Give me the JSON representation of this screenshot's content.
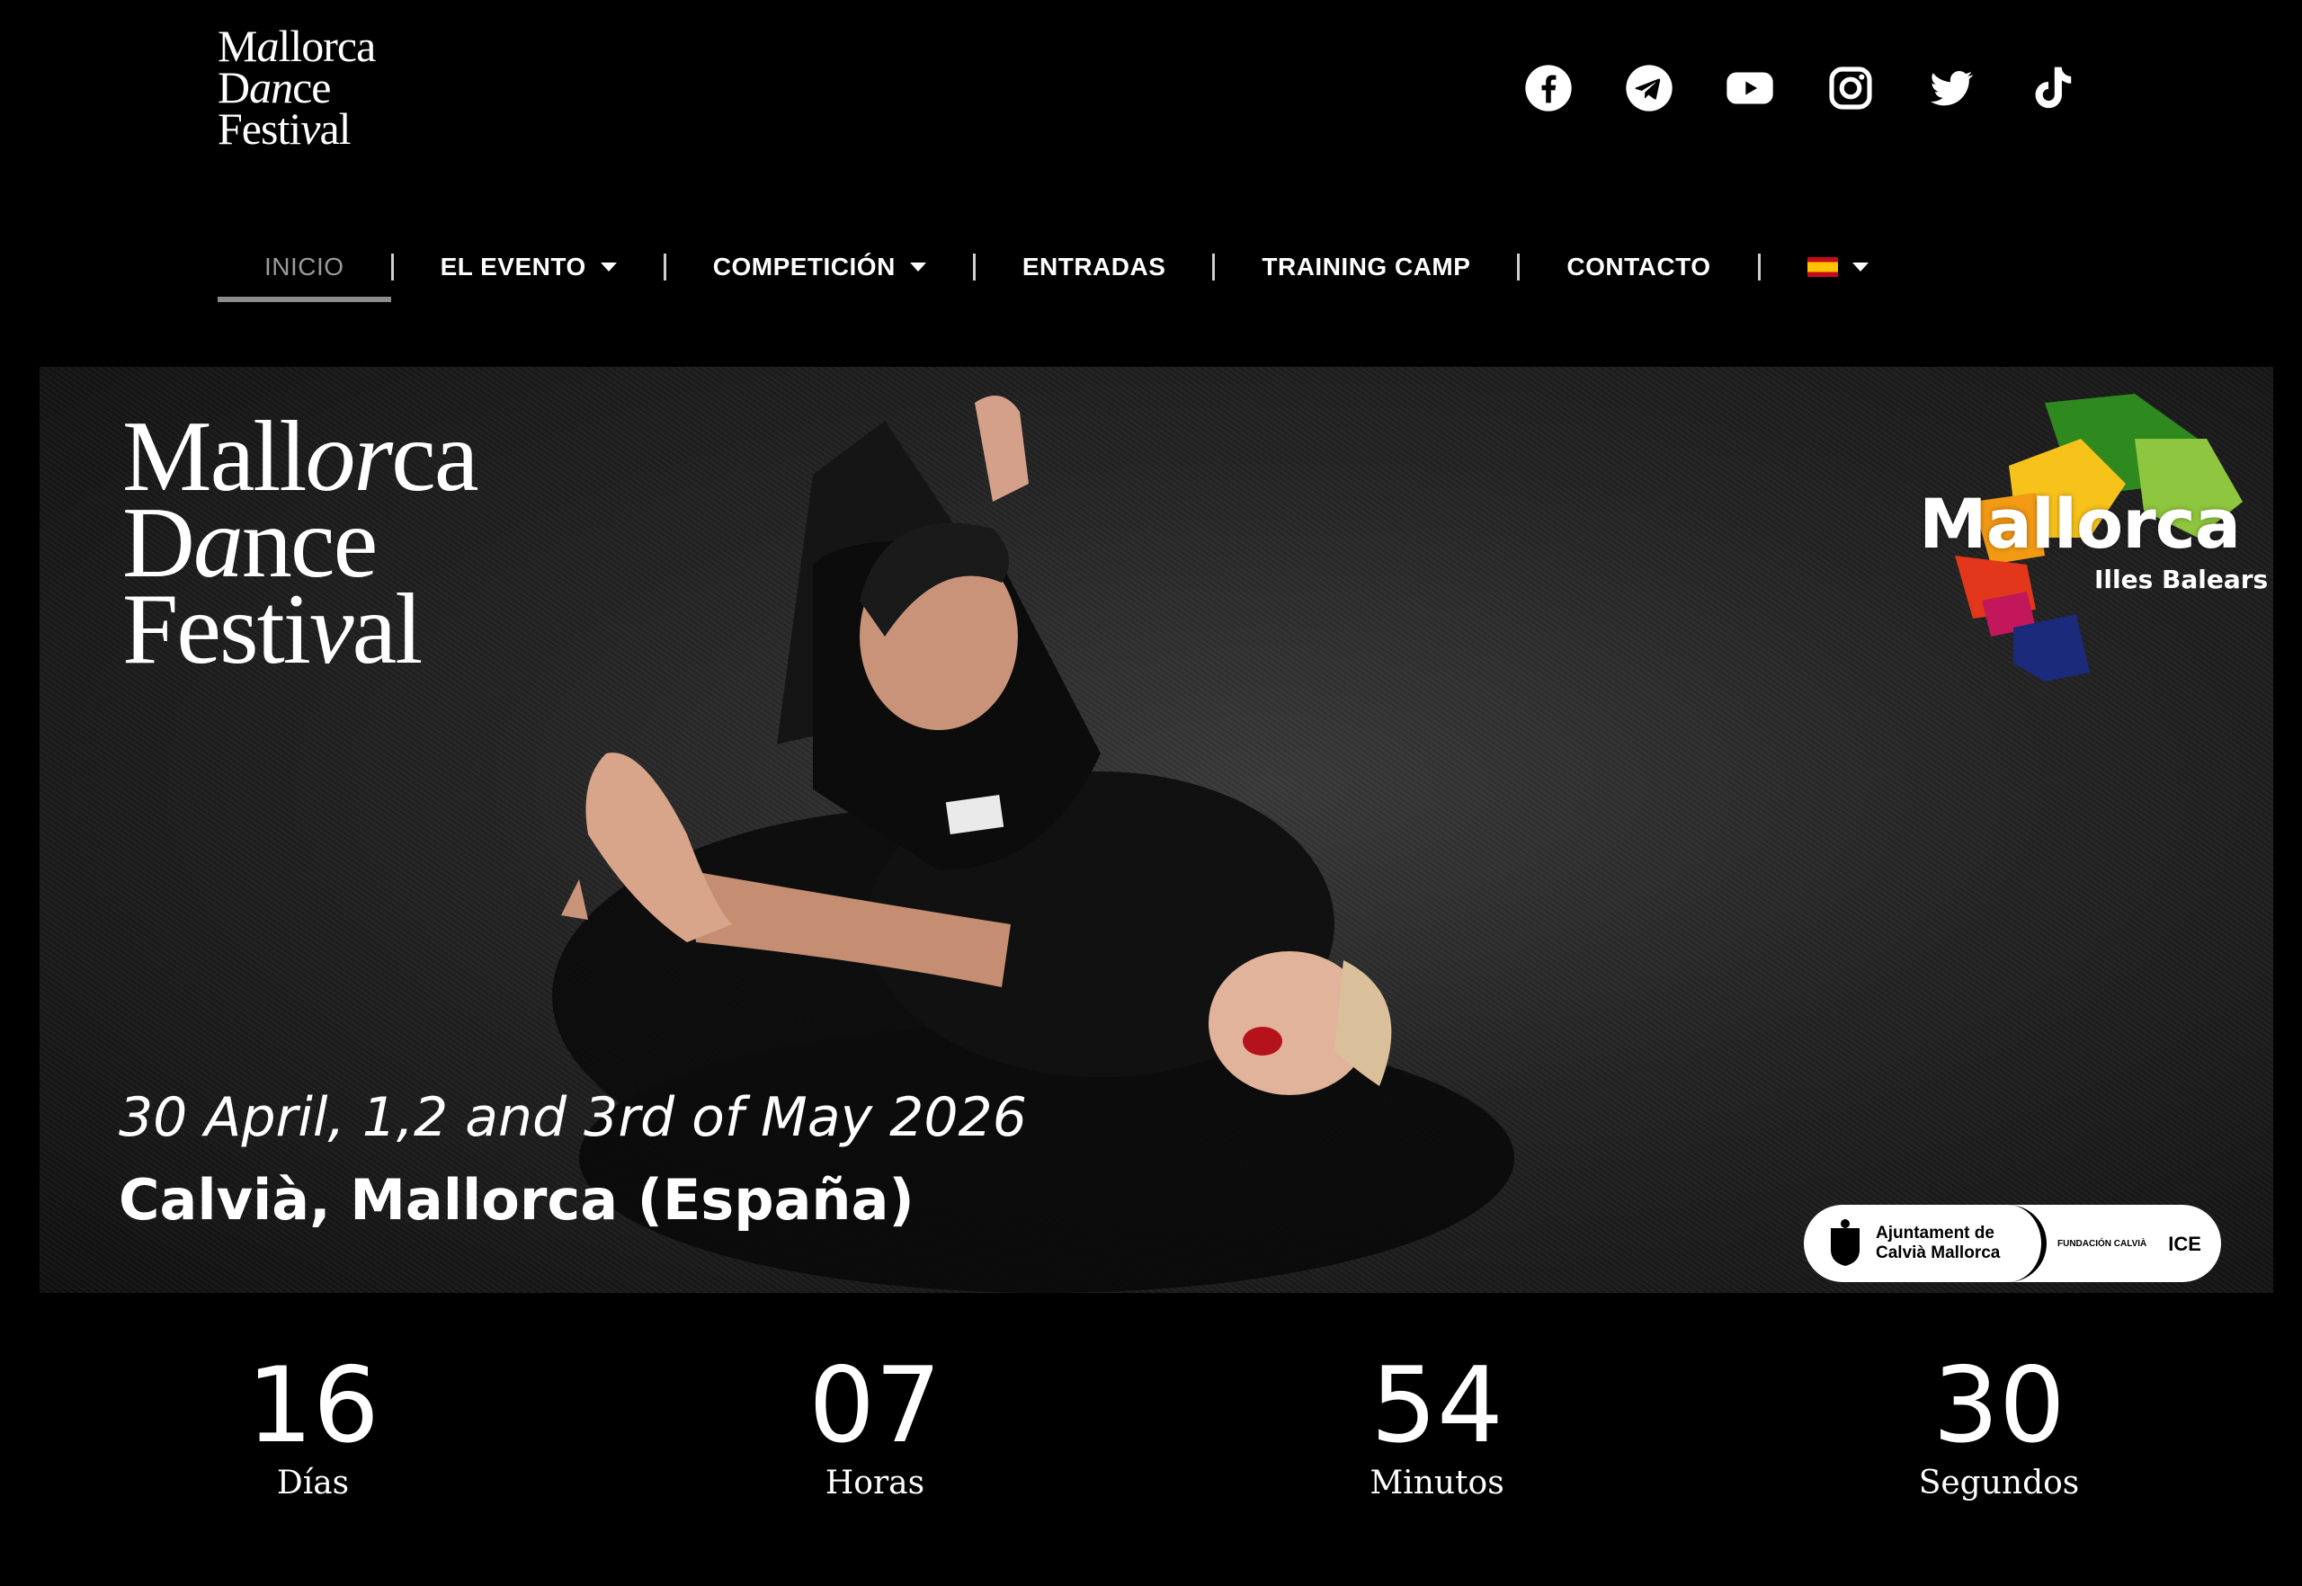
{
  "header": {
    "logo_lines": [
      "Mallorca",
      "Dance",
      "Festival"
    ]
  },
  "social": [
    {
      "name": "facebook-icon"
    },
    {
      "name": "telegram-icon"
    },
    {
      "name": "youtube-icon"
    },
    {
      "name": "instagram-icon"
    },
    {
      "name": "twitter-icon"
    },
    {
      "name": "tiktok-icon"
    }
  ],
  "nav": {
    "items": [
      {
        "label": "INICIO",
        "active": true
      },
      {
        "label": "EL EVENTO",
        "dropdown": true
      },
      {
        "label": "COMPETICIÓN",
        "dropdown": true
      },
      {
        "label": "ENTRADAS"
      },
      {
        "label": "TRAINING CAMP"
      },
      {
        "label": "CONTACTO"
      }
    ],
    "language": "es"
  },
  "banner": {
    "logo_lines": [
      "Mallorca",
      "Dance",
      "Festival"
    ],
    "date": "30 April, 1,2 and 3rd of May 2026",
    "place": "Calvià, Mallorca (España)",
    "brand": "Mallorca",
    "brand_sub": "Illes Balears",
    "sponsor": {
      "line1": "Ajuntament de",
      "line2": "Calvià Mallorca",
      "fundacion": "FUNDACIÓN CALVIÀ",
      "ice": "ICE"
    }
  },
  "countdown": [
    {
      "value": "16",
      "label": "Días"
    },
    {
      "value": "07",
      "label": "Horas"
    },
    {
      "value": "54",
      "label": "Minutos"
    },
    {
      "value": "30",
      "label": "Segundos"
    }
  ],
  "colors": {
    "background": "#000000",
    "active_nav": "#9a9a9a",
    "text": "#ffffff"
  }
}
